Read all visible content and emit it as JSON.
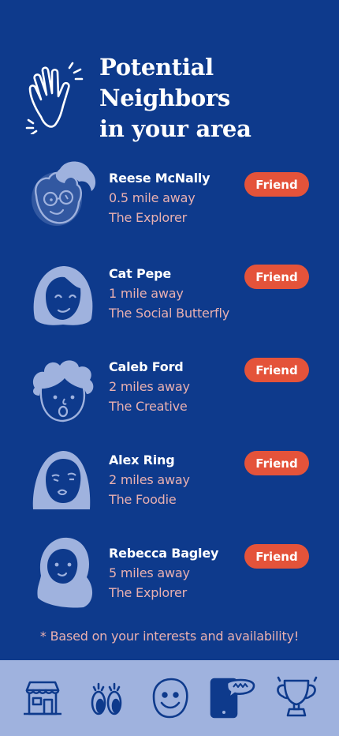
{
  "header": {
    "title_line1": "Potential",
    "title_line2": "Neighbors",
    "title_line3": "in your area",
    "icon": "waving-hand-icon"
  },
  "neighbors": [
    {
      "name": "Reese McNally",
      "distance": "0.5 mile away",
      "persona": "The Explorer",
      "button": "Friend",
      "avatar_icon": "curly-hair-glasses-avatar"
    },
    {
      "name": "Cat Pepe",
      "distance": "1 mile away",
      "persona": "The Social Butterfly",
      "button": "Friend",
      "avatar_icon": "bob-hair-avatar"
    },
    {
      "name": "Caleb Ford",
      "distance": "2 miles away",
      "persona": "The Creative",
      "button": "Friend",
      "avatar_icon": "curly-hair-avatar"
    },
    {
      "name": "Alex Ring",
      "distance": "2 miles away",
      "persona": "The Foodie",
      "button": "Friend",
      "avatar_icon": "hijab-avatar"
    },
    {
      "name": "Rebecca Bagley",
      "distance": "5 miles away",
      "persona": "The Explorer",
      "button": "Friend",
      "avatar_icon": "headscarf-avatar"
    }
  ],
  "footnote": "* Based on your interests and availability!",
  "bottom_nav": [
    "storefront-icon",
    "eyes-icon",
    "smiley-icon",
    "phone-chat-icon",
    "trophy-icon"
  ],
  "colors": {
    "background": "#0e3a8c",
    "accent": "#e4533a",
    "secondary_text": "#e9b0b0",
    "avatar_fill": "#9fb2de",
    "nav_bar": "#9fb2de"
  }
}
